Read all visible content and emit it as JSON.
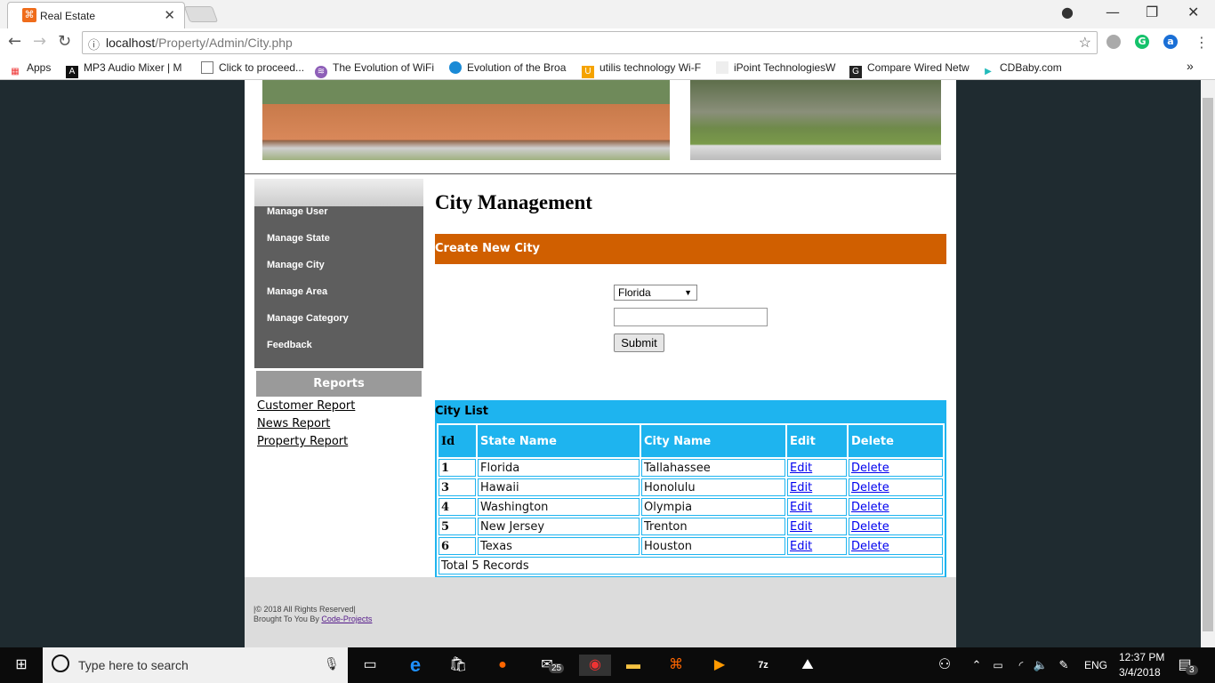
{
  "browser": {
    "tab_title": "Real Estate",
    "url_host": "localhost",
    "url_path": "/Property/Admin/City.php",
    "bookmarks": [
      {
        "label": "Apps",
        "icon": "apps-grid-icon"
      },
      {
        "label": "MP3 Audio Mixer | M",
        "icon": "mixer-icon"
      },
      {
        "label": "Click to proceed...",
        "icon": "page-icon"
      },
      {
        "label": "The Evolution of WiFi",
        "icon": "wifi-icon"
      },
      {
        "label": "Evolution of the Broa",
        "icon": "globe-icon"
      },
      {
        "label": "utilis technology Wi-F",
        "icon": "u-icon"
      },
      {
        "label": "iPoint TechnologiesW",
        "icon": "blank-icon"
      },
      {
        "label": "Compare Wired Netw",
        "icon": "g-icon"
      },
      {
        "label": "CDBaby.com",
        "icon": "cdbaby-icon"
      }
    ]
  },
  "sidebar": {
    "menu": [
      "Manage User",
      "Manage State",
      "Manage City",
      "Manage Area",
      "Manage Category",
      "Feedback"
    ],
    "reports_title": "Reports",
    "reports": [
      "Customer Report",
      "News Report",
      "Property Report"
    ]
  },
  "main": {
    "title": "City Management",
    "create_title": "Create New City",
    "state_select": "Florida",
    "city_input": "",
    "submit": "Submit",
    "list_title": "City List",
    "columns": [
      "Id",
      "State Name",
      "City Name",
      "Edit",
      "Delete"
    ],
    "rows": [
      {
        "id": "1",
        "state": "Florida",
        "city": "Tallahassee",
        "edit": "Edit",
        "delete": "Delete"
      },
      {
        "id": "3",
        "state": "Hawaii",
        "city": "Honolulu",
        "edit": "Edit",
        "delete": "Delete"
      },
      {
        "id": "4",
        "state": "Washington",
        "city": "Olympia",
        "edit": "Edit",
        "delete": "Delete"
      },
      {
        "id": "5",
        "state": "New Jersey",
        "city": "Trenton",
        "edit": "Edit",
        "delete": "Delete"
      },
      {
        "id": "6",
        "state": "Texas",
        "city": "Houston",
        "edit": "Edit",
        "delete": "Delete"
      }
    ],
    "total": "Total 5 Records"
  },
  "footer": {
    "copyright": "|© 2018 All Rights Reserved|",
    "brought": "Brought To You By ",
    "link": "Code-Projects"
  },
  "taskbar": {
    "search_placeholder": "Type here to search",
    "mail_badge": "25",
    "language": "ENG",
    "time": "12:37 PM",
    "date": "3/4/2018",
    "notifications": "3"
  },
  "colors": {
    "accent_orange": "#d05f00",
    "table_blue": "#1eb4ef",
    "menu_gray": "#5e5e5e"
  }
}
